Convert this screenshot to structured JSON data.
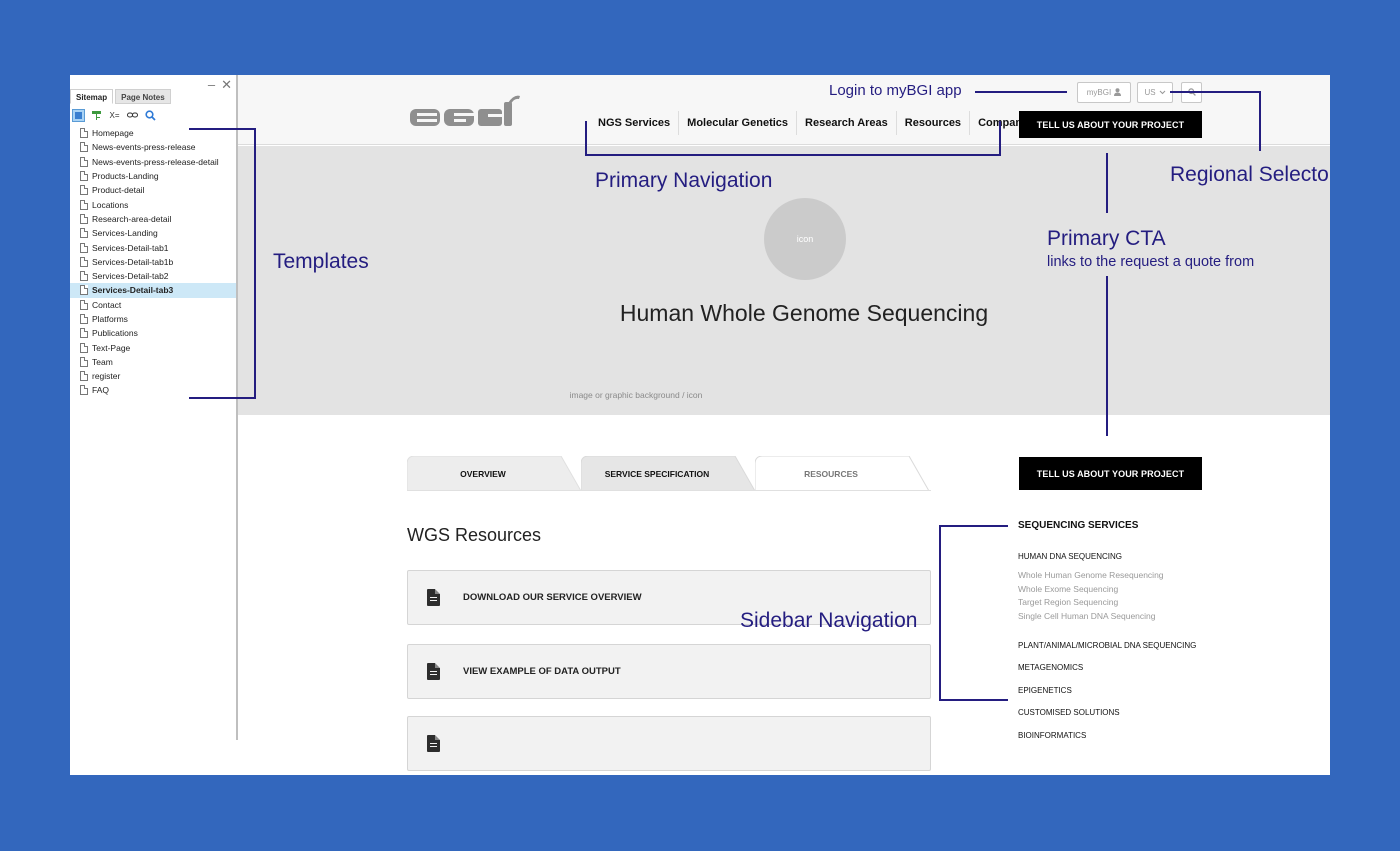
{
  "sitemap": {
    "tabs": [
      {
        "label": "Sitemap"
      },
      {
        "label": "Page Notes"
      }
    ],
    "toolbar_icons": [
      "add-page-icon",
      "add-folder-icon",
      "variable-icon",
      "link-icon",
      "search-icon"
    ],
    "items": [
      {
        "label": "Homepage"
      },
      {
        "label": "News-events-press-release"
      },
      {
        "label": "News-events-press-release-detail"
      },
      {
        "label": "Products-Landing"
      },
      {
        "label": "Product-detail"
      },
      {
        "label": "Locations"
      },
      {
        "label": "Research-area-detail"
      },
      {
        "label": "Services-Landing"
      },
      {
        "label": "Services-Detail-tab1"
      },
      {
        "label": "Services-Detail-tab1b"
      },
      {
        "label": "Services-Detail-tab2"
      },
      {
        "label": "Services-Detail-tab3"
      },
      {
        "label": "Contact"
      },
      {
        "label": "Platforms"
      },
      {
        "label": "Publications"
      },
      {
        "label": "Text-Page"
      },
      {
        "label": "Team"
      },
      {
        "label": "register"
      },
      {
        "label": "FAQ"
      }
    ],
    "selected_item": "Services-Detail-tab3"
  },
  "header": {
    "mybgi_label": "myBGI",
    "region_label": "US",
    "nav": [
      {
        "label": "NGS Services"
      },
      {
        "label": "Molecular Genetics"
      },
      {
        "label": "Research Areas"
      },
      {
        "label": "Resources"
      },
      {
        "label": "Company"
      }
    ],
    "cta_label": "TELL US ABOUT YOUR PROJECT"
  },
  "hero": {
    "icon_label": "icon",
    "title": "Human Whole Genome Sequencing",
    "note": "image or graphic background / icon"
  },
  "tabs": [
    {
      "label": "OVERVIEW"
    },
    {
      "label": "SERVICE SPECIFICATION"
    },
    {
      "label": "RESOURCES"
    }
  ],
  "active_tab": "RESOURCES",
  "body_cta_label": "TELL US ABOUT YOUR PROJECT",
  "resources": {
    "title": "WGS Resources",
    "cards": [
      {
        "label": "DOWNLOAD OUR SERVICE OVERVIEW"
      },
      {
        "label": "VIEW EXAMPLE OF DATA OUTPUT"
      },
      {
        "label": ""
      }
    ]
  },
  "sidebar": {
    "heading": "SEQUENCING SERVICES",
    "sub_heading": "HUMAN DNA SEQUENCING",
    "links": [
      {
        "label": "Whole Human Genome Resequencing"
      },
      {
        "label": "Whole Exome Sequencing"
      },
      {
        "label": "Target Region Sequencing"
      },
      {
        "label": "Single Cell Human DNA Sequencing"
      }
    ],
    "categories": [
      {
        "label": "PLANT/ANIMAL/MICROBIAL DNA SEQUENCING"
      },
      {
        "label": "METAGENOMICS"
      },
      {
        "label": "EPIGENETICS"
      },
      {
        "label": "CUSTOMISED SOLUTIONS"
      },
      {
        "label": "BIOINFORMATICS"
      }
    ]
  },
  "annotations": {
    "templates": "Templates",
    "primary_navigation": "Primary Navigation",
    "login": "Login to myBGI app",
    "regional_selector": "Regional Selecto",
    "primary_cta": "Primary CTA",
    "primary_cta_note": "links to the request a quote from",
    "sidebar_navigation": "Sidebar Navigation"
  },
  "colors": {
    "page_background": "#3367bd",
    "annotation": "#241d80",
    "selected_row": "#cde8f7"
  }
}
